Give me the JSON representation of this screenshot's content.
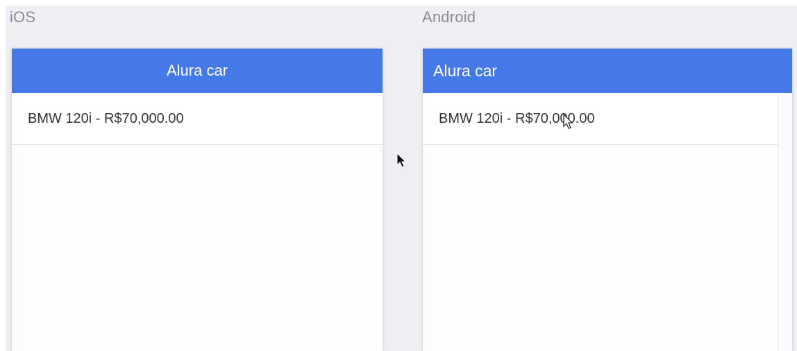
{
  "ios": {
    "platform_label": "iOS",
    "app_title": "Alura car",
    "items": [
      {
        "label": "BMW 120i - R$70,000.00"
      }
    ]
  },
  "android": {
    "platform_label": "Android",
    "app_title": "Alura car",
    "items": [
      {
        "label": "BMW 120i - R$70,000.00"
      }
    ]
  },
  "colors": {
    "accent": "#4479e7",
    "background": "#eeeef3",
    "label": "#8a8a90"
  },
  "icons": [
    "mouse-pointer-icon",
    "mouse-pointer-outline-icon"
  ]
}
